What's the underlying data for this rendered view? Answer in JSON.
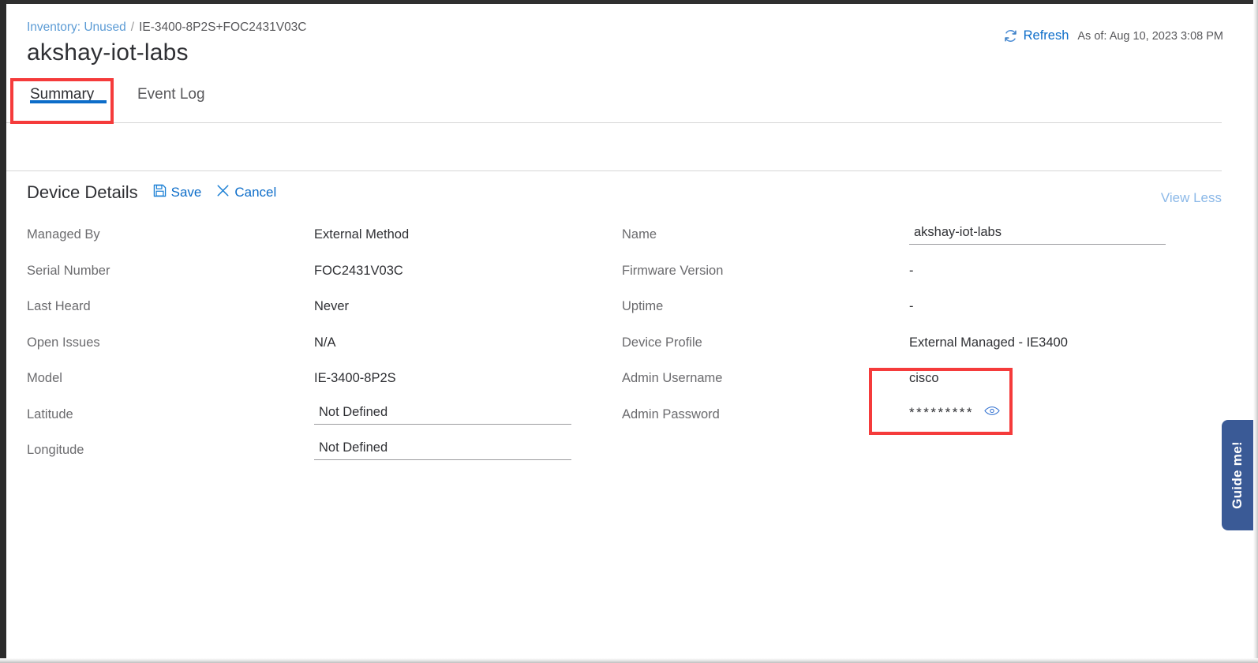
{
  "window": {
    "accent_color": "#0d6dc9",
    "highlight_color": "#f53b3b",
    "guide_color": "#3a5a96"
  },
  "header": {
    "breadcrumb": {
      "parent": "Inventory: Unused",
      "separator": "/",
      "current": "IE-3400-8P2S+FOC2431V03C"
    },
    "title": "akshay-iot-labs",
    "refresh_label": "Refresh",
    "refresh_icon": "refresh-circular-arrow-icon",
    "as_of": "As of: Aug 10, 2023 3:08 PM"
  },
  "tabs": [
    {
      "label": "Summary",
      "active": true
    },
    {
      "label": "Event Log",
      "active": false
    }
  ],
  "device_details": {
    "title": "Device Details",
    "save_label": "Save",
    "save_icon": "floppy-disk-icon",
    "cancel_label": "Cancel",
    "cancel_icon": "close-x-icon",
    "view_toggle_label": "View Less"
  },
  "left_fields": [
    {
      "label": "Managed By",
      "value": "External Method",
      "type": "text"
    },
    {
      "label": "Serial Number",
      "value": "FOC2431V03C",
      "type": "text"
    },
    {
      "label": "Last Heard",
      "value": "Never",
      "type": "text"
    },
    {
      "label": "Open Issues",
      "value": "N/A",
      "type": "text"
    },
    {
      "label": "Model",
      "value": "IE-3400-8P2S",
      "type": "text"
    },
    {
      "label": "Latitude",
      "value": "Not Defined",
      "type": "input"
    },
    {
      "label": "Longitude",
      "value": "Not Defined",
      "type": "input"
    }
  ],
  "right_fields": [
    {
      "label": "Name",
      "value": "akshay-iot-labs",
      "type": "input"
    },
    {
      "label": "Firmware Version",
      "value": "-",
      "type": "text"
    },
    {
      "label": "Uptime",
      "value": "-",
      "type": "text"
    },
    {
      "label": "Device Profile",
      "value": "External Managed - IE3400",
      "type": "text"
    },
    {
      "label": "Admin Username",
      "value": "cisco",
      "type": "text"
    },
    {
      "label": "Admin Password",
      "value": "*********",
      "type": "password"
    }
  ],
  "password_toggle_icon": "eye-icon",
  "guide": {
    "label": "Guide me!"
  }
}
